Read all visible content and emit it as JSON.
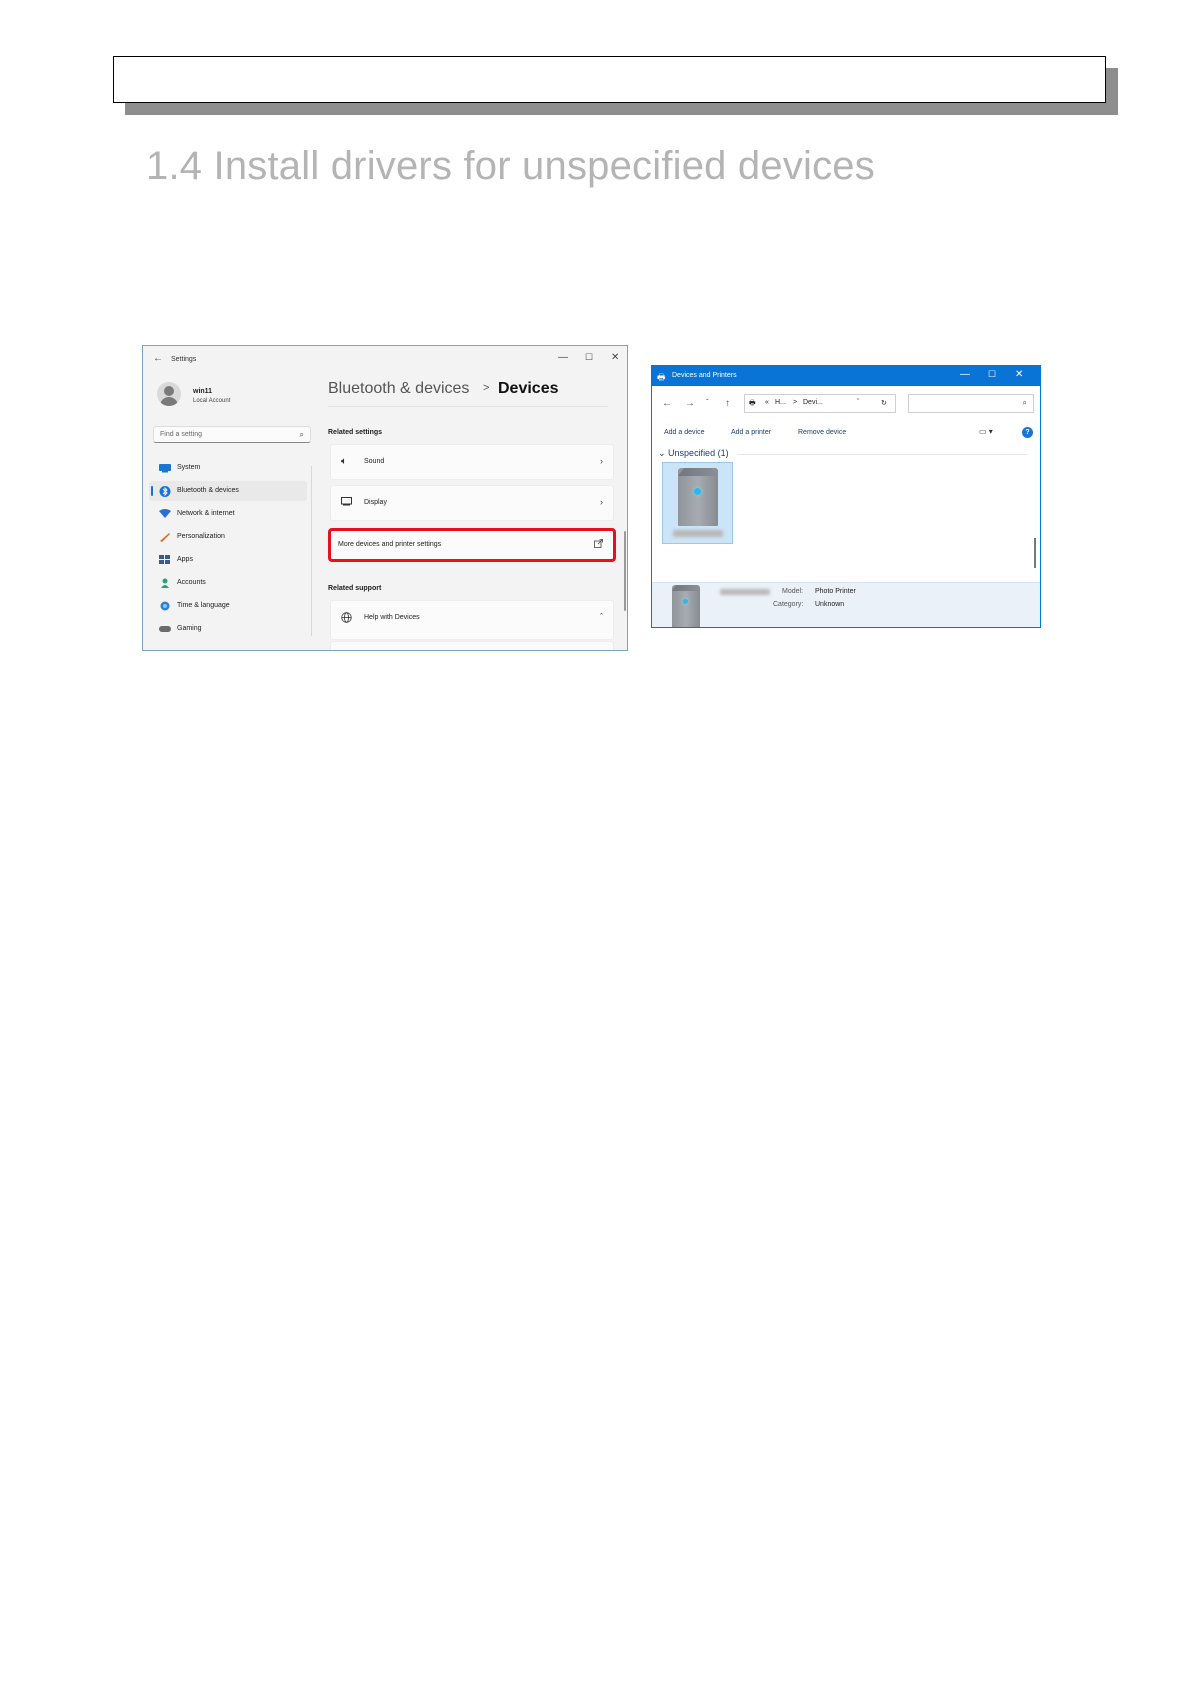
{
  "section_title": "1.4 Install drivers for unspecified devices",
  "settings_window": {
    "title": "Settings",
    "controls": {
      "minimize": "—",
      "maximize": "☐",
      "close": "✕"
    },
    "user": {
      "name": "win11",
      "account_type": "Local Account"
    },
    "search_placeholder": "Find a setting",
    "nav_items": [
      {
        "label": "System",
        "icon": "monitor-icon"
      },
      {
        "label": "Bluetooth & devices",
        "icon": "bluetooth-icon",
        "selected": true
      },
      {
        "label": "Network & internet",
        "icon": "wifi-icon"
      },
      {
        "label": "Personalization",
        "icon": "brush-icon"
      },
      {
        "label": "Apps",
        "icon": "apps-icon"
      },
      {
        "label": "Accounts",
        "icon": "person-icon"
      },
      {
        "label": "Time & language",
        "icon": "globe-icon"
      },
      {
        "label": "Gaming",
        "icon": "gamepad-icon"
      }
    ],
    "breadcrumb": {
      "parent": "Bluetooth & devices",
      "separator": ">",
      "current": "Devices"
    },
    "related_settings": {
      "heading": "Related settings",
      "items": [
        {
          "label": "Sound",
          "icon": "speaker-icon"
        },
        {
          "label": "Display",
          "icon": "display-icon"
        },
        {
          "label": "More devices and printer settings",
          "icon": "external-link-icon",
          "highlighted": true
        }
      ]
    },
    "related_support": {
      "heading": "Related support",
      "items": [
        {
          "label": "Help with Devices",
          "icon": "globe-icon"
        }
      ]
    },
    "highlight_color": "#e8101b"
  },
  "devices_window": {
    "title": "Devices and Printers",
    "title_bar_color": "#0a74d6",
    "address": {
      "prefix": "«",
      "part1": "H...",
      "separator": ">",
      "part2": "Devi..."
    },
    "commands": [
      "Add a device",
      "Add a printer",
      "Remove device"
    ],
    "group_label": "Unspecified (1)",
    "details": {
      "model_label": "Model:",
      "model_value": "Photo Printer",
      "category_label": "Category:",
      "category_value": "Unknown"
    }
  }
}
